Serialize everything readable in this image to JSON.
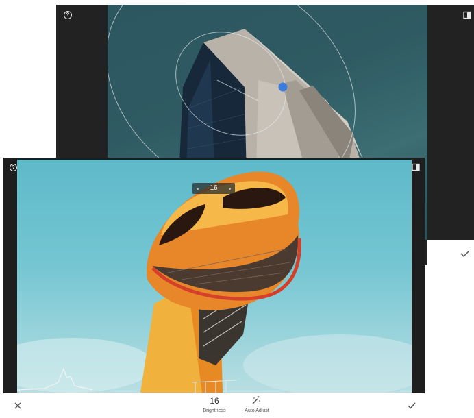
{
  "back_screen": {
    "help_icon": "help-circle-icon",
    "compare_icon": "compare-icon",
    "apply_icon": "checkmark-icon",
    "help_glyph": "?"
  },
  "front_screen": {
    "help_icon": "help-circle-icon",
    "help_glyph": "?",
    "compare_icon": "compare-icon",
    "adjust_value": "16",
    "histogram_icon": "histogram-icon"
  },
  "bottom_bar": {
    "close_icon": "close-icon",
    "brightness_value": "16",
    "brightness_label": "Brightness",
    "auto_adjust_icon": "magic-wand-icon",
    "auto_adjust_label": "Auto Adjust",
    "apply_icon": "checkmark-icon"
  },
  "colors": {
    "accent_blue": "#3b7ddd",
    "dark_frame": "#222222",
    "orange_tower": "#e8862a"
  }
}
